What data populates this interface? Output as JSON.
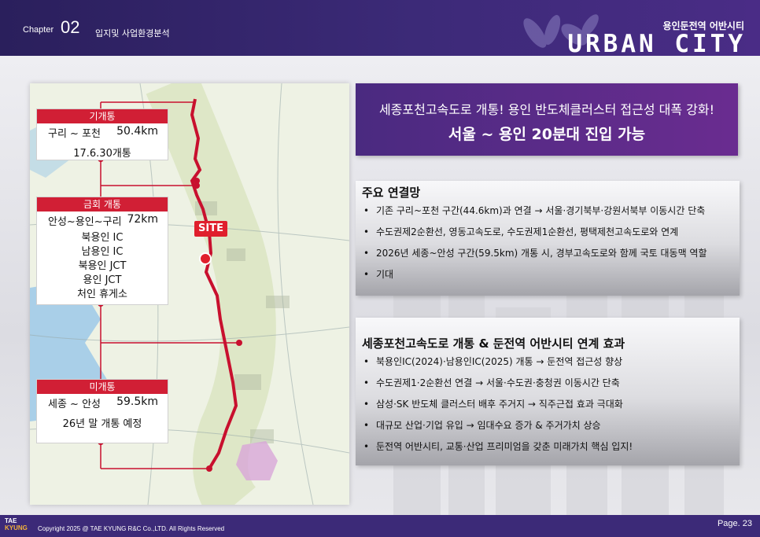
{
  "header": {
    "chapter_label": "Chapter",
    "chapter_num": "02",
    "subtitle": "입지및 사업환경분석",
    "brand_sub": "용인둔전역 어반시티",
    "brand_main": "URBAN CITY"
  },
  "map": {
    "labels": [
      {
        "status": "기개통",
        "route": "구리 ~ 포천",
        "length": "50.4km",
        "note": "17.6.30개통"
      },
      {
        "status": "금회 개통",
        "route": "안성~용인~구리",
        "length": "72km",
        "ics": [
          "북용인 IC",
          "남용인 IC",
          "북용인 JCT",
          "용인 JCT",
          "처인 휴게소"
        ]
      },
      {
        "status": "미개통",
        "route": "세종 ~ 안성",
        "length": "59.5km",
        "note": "26년 말 개통 예정"
      }
    ],
    "site_label": "SITE",
    "route_color": "#c8102e"
  },
  "callout": {
    "line1": "세종포천고속도로 개통! 용인 반도체클러스터 접근성 대폭 강화!",
    "line2": "서울 ~ 용인 20분대 진입 가능"
  },
  "section1": {
    "title": "주요 연결망",
    "items": [
      "기존 구리~포천 구간(44.6km)과 연결 → 서울·경기북부·강원서북부 이동시간 단축",
      "수도권제2순환선, 영동고속도로, 수도권제1순환선, 평택제천고속도로와 연계",
      "2026년 세종~안성 구간(59.5km) 개통 시, 경부고속도로와 함께 국토 대동맥 역할",
      "기대"
    ]
  },
  "section2": {
    "title": "세종포천고속도로 개통 & 둔전역 어반시티 연계 효과",
    "items": [
      "북용인IC(2024)·남용인IC(2025) 개통 → 둔전역 접근성 향상",
      "수도권제1·2순환선 연결 → 서울·수도권·충청권 이동시간 단축",
      "삼성·SK 반도체 클러스터 배후 주거지 → 직주근접 효과 극대화",
      "대규모 산업·기업 유입 → 임대수요 증가 & 주거가치 상승",
      "둔전역 어반시티, 교통·산업 프리미엄을 갖춘 미래가치 핵심 입지!"
    ]
  },
  "footer": {
    "logo_line1": "TAE",
    "logo_line2": "KYUNG",
    "copyright": "Copyright 2025 @ TAE KYUNG R&C Co.,LTD. All Rights Reserved",
    "page": "Page. 23"
  }
}
